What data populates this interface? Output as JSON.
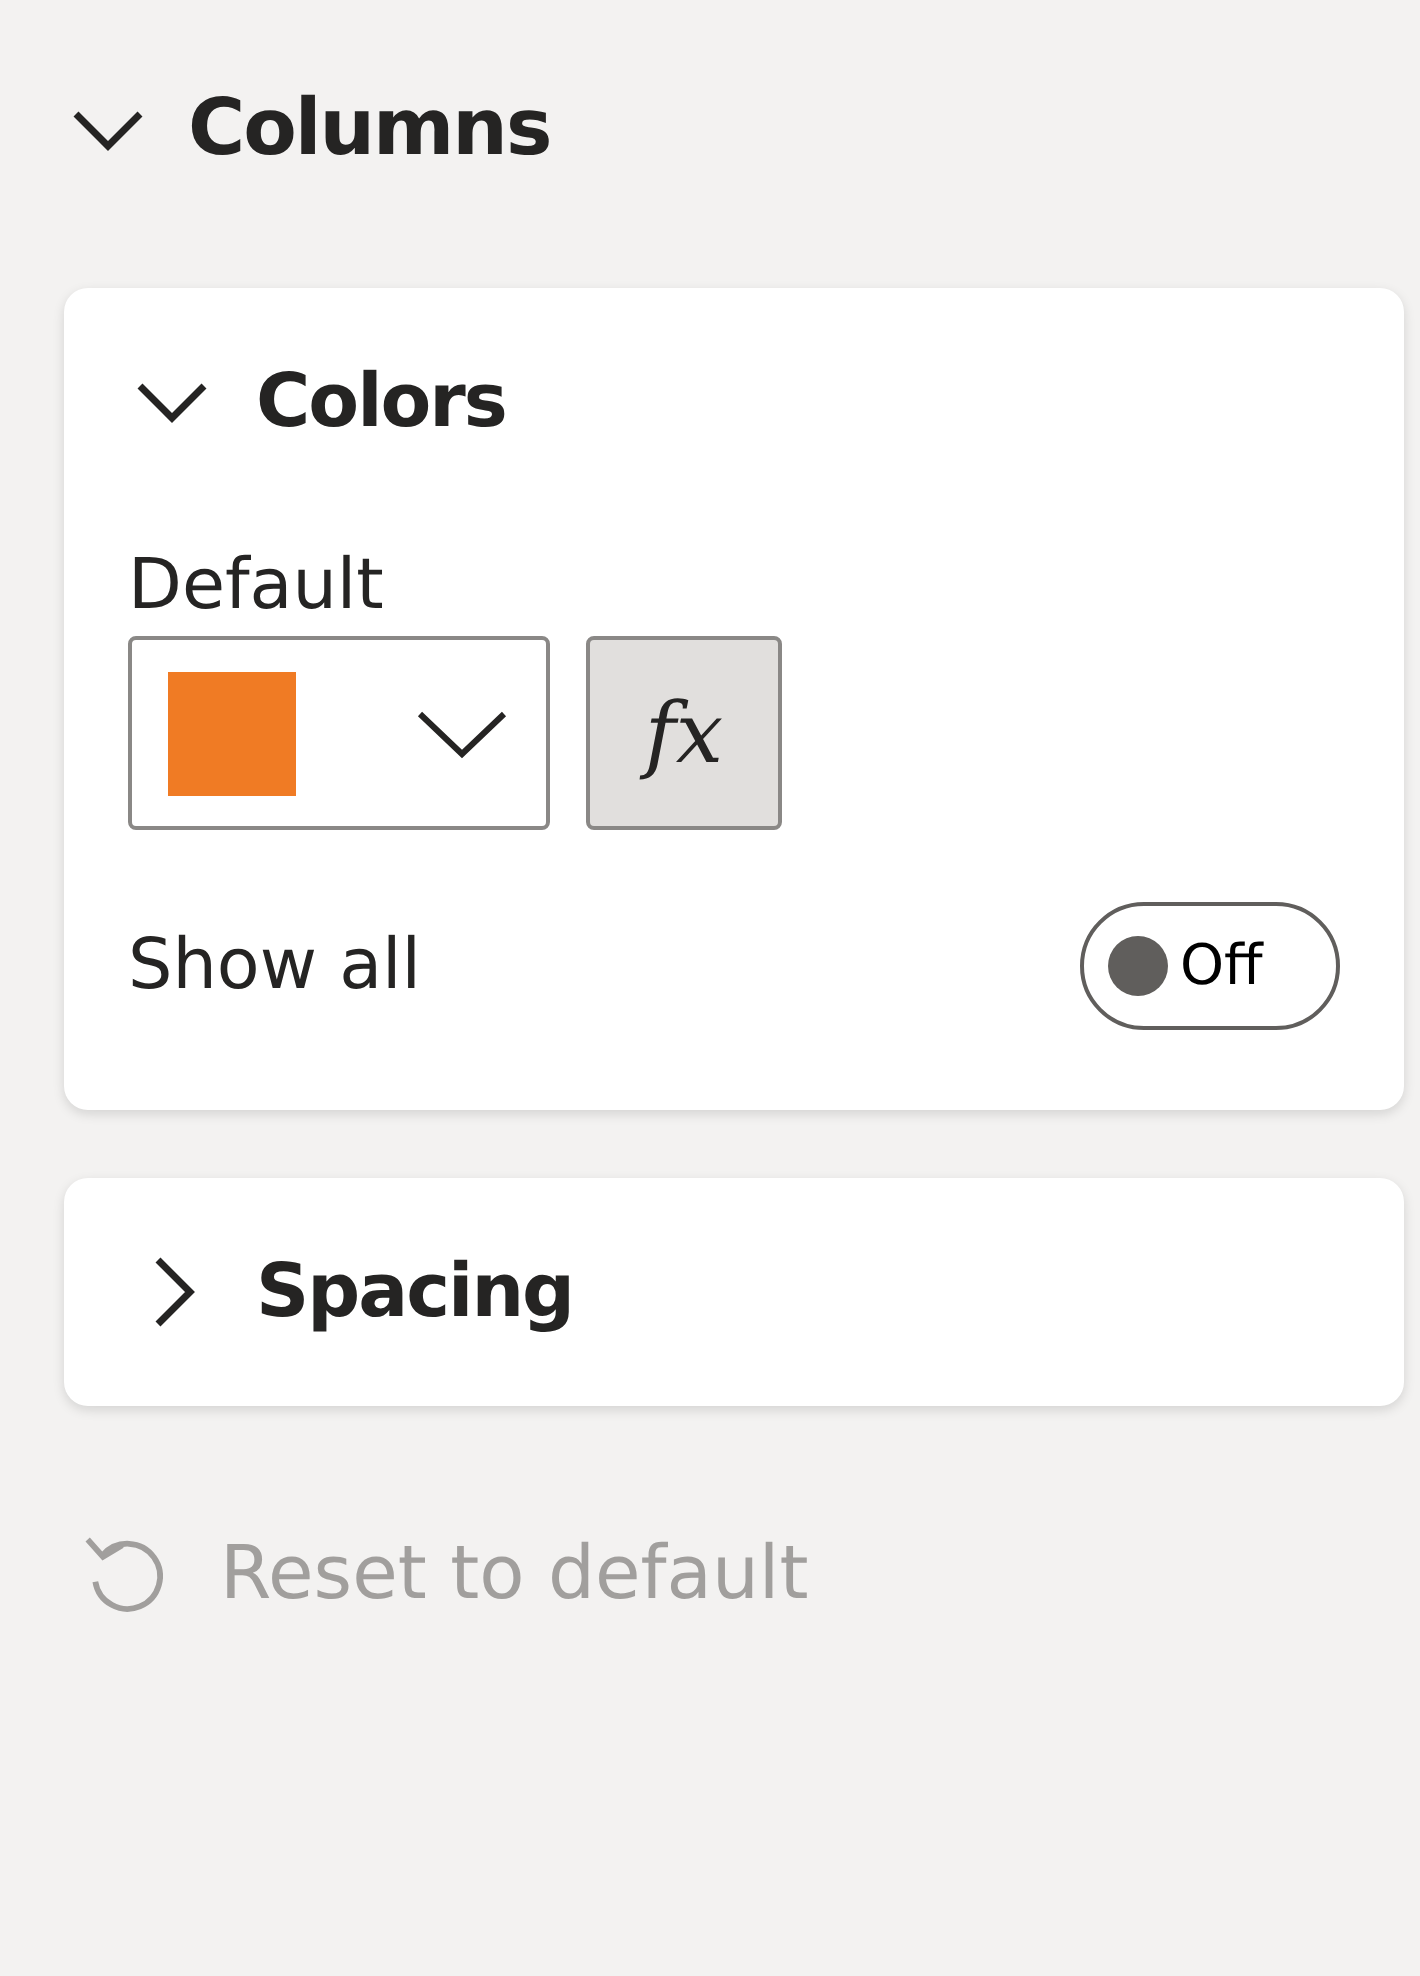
{
  "section": {
    "title": "Columns",
    "expanded": true
  },
  "cards": [
    {
      "title": "Colors",
      "expanded": true,
      "default_label": "Default",
      "color": "#f07b24",
      "fx_button": "fx",
      "show_all": {
        "label": "Show all",
        "on": false,
        "state_text": "Off"
      }
    },
    {
      "title": "Spacing",
      "expanded": false
    }
  ],
  "reset": {
    "label": "Reset to default",
    "disabled": true
  }
}
